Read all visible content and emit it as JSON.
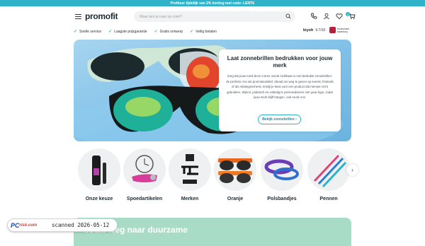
{
  "topbar": {
    "text": "Profiteer tijdelijk van 2% korting met code: LENTE"
  },
  "header": {
    "logo": "promofit",
    "search_placeholder": "Waar ben je naar op zoek?",
    "cart_count": "0"
  },
  "usps": [
    "Snelle service",
    "Laagste prijsgarantie",
    "Gratis ontwerp",
    "Veilig betalen"
  ],
  "rating": {
    "brand": "kiyoh",
    "score": "9.7/10"
  },
  "thuiswinkel": "thuiswinkel waarborg",
  "hero": {
    "title": "Laat zonnebrillen bedrukken voor jouw merk",
    "text": "Zorg dat jouw merk deze zomer overal zichtbaar is met bedrukte zonnebrillen: de perfecte zon als promotieartikel. Ideaal om weg te geven op events, festivals of als relatiegeschenk, terwijl je kiest voor een product dat mensen écht gebruiken. Stijlvol, praktisch en volledig te personaliseren met jouw logo, zodat jouw merk blijft hangen, ook na de zon.",
    "button": "Bekijk zonnebrillen ›"
  },
  "categories": [
    {
      "label": "Onze keuze"
    },
    {
      "label": "Spoedartikelen"
    },
    {
      "label": "Merken"
    },
    {
      "label": "Oranje"
    },
    {
      "label": "Polsbandjes"
    },
    {
      "label": "Pennen"
    }
  ],
  "bottom_banner": {
    "title": "Jouw weg naar duurzame"
  },
  "watermark": {
    "logo_main": "PC",
    "logo_sub": "risk.com",
    "text": "scanned 2026-05-12"
  },
  "colors": {
    "accent": "#2fb3c9",
    "hero_bg": "#7fc0e8",
    "banner_green": "#a8dcc7"
  }
}
